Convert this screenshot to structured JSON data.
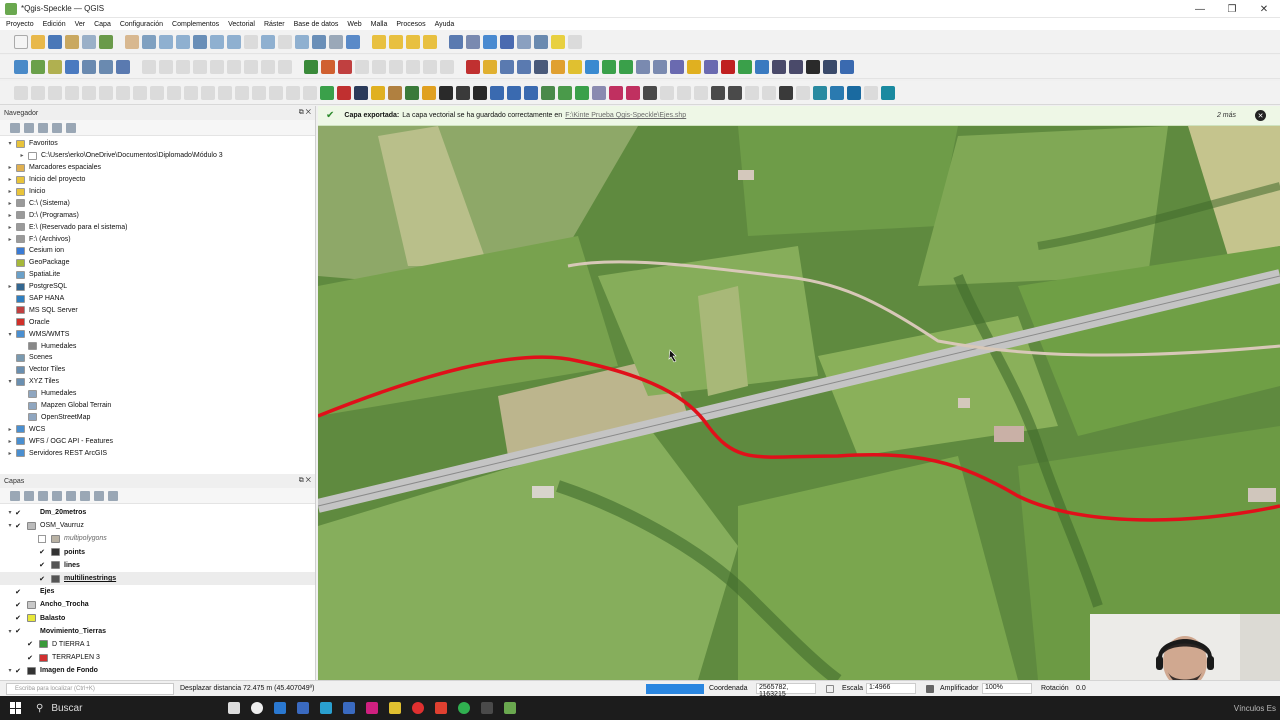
{
  "window": {
    "title": "*Qgis-Speckle — QGIS",
    "min": "—",
    "max": "❐",
    "close": "✕"
  },
  "menu": [
    "Proyecto",
    "Edición",
    "Ver",
    "Capa",
    "Configuración",
    "Complementos",
    "Vectorial",
    "Ráster",
    "Base de datos",
    "Web",
    "Malla",
    "Procesos",
    "Ayuda"
  ],
  "navigator": {
    "title": "Navegador",
    "items": [
      {
        "label": "Favoritos",
        "exp": "▾",
        "icon": "#e8c33a"
      },
      {
        "label": "C:\\Users\\erko\\OneDrive\\Documentos\\Diplomado\\Módulo 3",
        "exp": "▸",
        "icon": "#ffffff",
        "indent": 1
      },
      {
        "label": "Marcadores espaciales",
        "exp": "▸",
        "icon": "#e0b050"
      },
      {
        "label": "Inicio del proyecto",
        "exp": "▸",
        "icon": "#e8c33a"
      },
      {
        "label": "Inicio",
        "exp": "▸",
        "icon": "#e8c33a"
      },
      {
        "label": "C:\\ (Sistema)",
        "exp": "▸",
        "icon": "#9a9a9a"
      },
      {
        "label": "D:\\ (Programas)",
        "exp": "▸",
        "icon": "#9a9a9a"
      },
      {
        "label": "E:\\ (Reservado para el sistema)",
        "exp": "▸",
        "icon": "#9a9a9a"
      },
      {
        "label": "F:\\ (Archivos)",
        "exp": "▸",
        "icon": "#9a9a9a"
      },
      {
        "label": "Cesium ion",
        "exp": "",
        "icon": "#3a7bd5"
      },
      {
        "label": "GeoPackage",
        "exp": "",
        "icon": "#a6b83a"
      },
      {
        "label": "SpatiaLite",
        "exp": "",
        "icon": "#6aa0c8"
      },
      {
        "label": "PostgreSQL",
        "exp": "▸",
        "icon": "#336791"
      },
      {
        "label": "SAP HANA",
        "exp": "",
        "icon": "#2f7fc1"
      },
      {
        "label": "MS SQL Server",
        "exp": "",
        "icon": "#c04040"
      },
      {
        "label": "Oracle",
        "exp": "",
        "icon": "#d0302a"
      },
      {
        "label": "WMS/WMTS",
        "exp": "▾",
        "icon": "#4a8fd0"
      },
      {
        "label": "Humedales",
        "exp": "",
        "icon": "#888888",
        "indent": 1
      },
      {
        "label": "Scenes",
        "exp": "",
        "icon": "#7a9ab0"
      },
      {
        "label": "Vector Tiles",
        "exp": "",
        "icon": "#6a8fb0"
      },
      {
        "label": "XYZ Tiles",
        "exp": "▾",
        "icon": "#6a8fb0"
      },
      {
        "label": "Humedales",
        "exp": "",
        "icon": "#8fa6c0",
        "indent": 1
      },
      {
        "label": "Mapzen Global Terrain",
        "exp": "",
        "icon": "#8fa6c0",
        "indent": 1
      },
      {
        "label": "OpenStreetMap",
        "exp": "",
        "icon": "#8fa6c0",
        "indent": 1
      },
      {
        "label": "WCS",
        "exp": "▸",
        "icon": "#4a8fd0"
      },
      {
        "label": "WFS / OGC API - Features",
        "exp": "▸",
        "icon": "#4a8fd0"
      },
      {
        "label": "Servidores REST ArcGIS",
        "exp": "▸",
        "icon": "#4a8fd0"
      }
    ]
  },
  "layers": {
    "title": "Capas",
    "items": [
      {
        "label": "Dm_20metros",
        "bold": true,
        "check": "✔",
        "exp": "▾",
        "icon": "",
        "indent": 0
      },
      {
        "label": "OSM_Vaurruz",
        "bold": false,
        "check": "✔",
        "exp": "▾",
        "icon": "#bbbbbb",
        "indent": 0
      },
      {
        "label": "multipolygons",
        "ital": true,
        "check": "",
        "exp": "",
        "icon": "#b9b2a4",
        "indent": 2
      },
      {
        "label": "points",
        "bold": true,
        "check": "✔",
        "exp": "",
        "icon": "#333333",
        "indent": 2
      },
      {
        "label": "lines",
        "bold": true,
        "check": "✔",
        "exp": "",
        "icon": "#555555",
        "indent": 2
      },
      {
        "label": "multilinestrings",
        "bold": true,
        "underline": true,
        "check": "✔",
        "exp": "",
        "icon": "#555555",
        "indent": 2
      },
      {
        "label": "Ejes",
        "bold": true,
        "check": "✔",
        "exp": "",
        "icon": "",
        "indent": 0
      },
      {
        "label": "Ancho_Trocha",
        "bold": true,
        "check": "✔",
        "exp": "",
        "icon": "#c8c8c8",
        "indent": 0
      },
      {
        "label": "Balasto",
        "bold": true,
        "check": "✔",
        "exp": "",
        "icon": "#e8e83a",
        "indent": 0
      },
      {
        "label": "Movimiento_Tierras",
        "bold": true,
        "check": "✔",
        "exp": "▾",
        "icon": "",
        "indent": 0
      },
      {
        "label": "D TIERRA 1",
        "bold": false,
        "check": "✔",
        "exp": "",
        "icon": "#3a9a3a",
        "indent": 1
      },
      {
        "label": "TERRAPLEN 3",
        "bold": false,
        "check": "✔",
        "exp": "",
        "icon": "#d03030",
        "indent": 1
      },
      {
        "label": "Imagen de Fondo",
        "bold": true,
        "check": "✔",
        "exp": "▾",
        "icon": "#333333",
        "indent": 0
      }
    ]
  },
  "message": {
    "title": "Capa exportada:",
    "text": "La capa vectorial se ha guardado correctamente en",
    "link": "F:\\Kinte Prueba Qgis-Speckle\\Ejes.shp",
    "time": "2 más",
    "close": "✕"
  },
  "status": {
    "search_placeholder": "Escriba para localizar (Ctrl+K)",
    "measure": "Desplazar distancia 72.475 m (45.407049º)",
    "coord_label": "Coordenada",
    "coord_value": "2565782, 1163215",
    "scale_label": "Escala",
    "scale_value": "1:4966",
    "mag_label": "Amplificador",
    "mag_value": "100%",
    "rot_label": "Rotación",
    "rot_value": "0.0",
    "progress": 1.0
  },
  "taskbar": {
    "search": "Buscar",
    "right": "Vínculos  Es"
  },
  "colors": {
    "accent": "#2a86e0",
    "route": "#e0101a",
    "msg_bg": "#eef7e6"
  }
}
